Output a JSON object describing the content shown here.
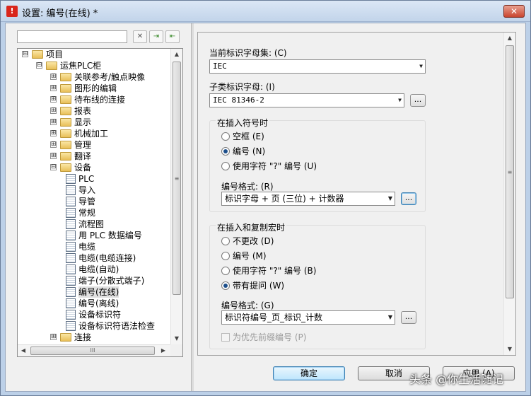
{
  "window": {
    "title": "设置: 编号(在线) *",
    "close_label": "✕",
    "app_icon": "warning-triangle-icon"
  },
  "search": {
    "value": "",
    "placeholder": ""
  },
  "toolbar": {
    "clear_label": "✕",
    "btn2_label": "⇥",
    "btn3_label": "⇤"
  },
  "tree": {
    "items": [
      {
        "label": "项目",
        "expander": "⊟",
        "icon": "folder"
      },
      {
        "label": "运焦PLC柜",
        "expander": "⊟",
        "icon": "folder"
      },
      {
        "label": "关联参考/触点映像",
        "expander": "⊞",
        "icon": "folder"
      },
      {
        "label": "图形的编辑",
        "expander": "⊞",
        "icon": "folder"
      },
      {
        "label": "待布线的连接",
        "expander": "⊞",
        "icon": "folder"
      },
      {
        "label": "报表",
        "expander": "⊞",
        "icon": "folder"
      },
      {
        "label": "显示",
        "expander": "⊞",
        "icon": "folder"
      },
      {
        "label": "机械加工",
        "expander": "⊞",
        "icon": "folder"
      },
      {
        "label": "管理",
        "expander": "⊞",
        "icon": "folder"
      },
      {
        "label": "翻译",
        "expander": "⊞",
        "icon": "folder"
      },
      {
        "label": "设备",
        "expander": "⊟",
        "icon": "folder"
      },
      {
        "label": "PLC",
        "icon": "page"
      },
      {
        "label": "导入",
        "icon": "page"
      },
      {
        "label": "导管",
        "icon": "page"
      },
      {
        "label": "常规",
        "icon": "page"
      },
      {
        "label": "流程图",
        "icon": "page"
      },
      {
        "label": "用 PLC 数据编号",
        "icon": "page"
      },
      {
        "label": "电缆",
        "icon": "page"
      },
      {
        "label": "电缆(电缆连接)",
        "icon": "page"
      },
      {
        "label": "电缆(自动)",
        "icon": "page"
      },
      {
        "label": "端子(分散式端子)",
        "icon": "page"
      },
      {
        "label": "编号(在线)",
        "icon": "page",
        "selected": true
      },
      {
        "label": "编号(离线)",
        "icon": "page"
      },
      {
        "label": "设备标识符",
        "icon": "page"
      },
      {
        "label": "设备标识符语法检查",
        "icon": "page"
      },
      {
        "label": "连接",
        "expander": "⊞",
        "icon": "folder"
      }
    ],
    "vscroll_up": "▲",
    "vscroll_down": "▼",
    "hscroll_left": "◀",
    "hscroll_right": "▶",
    "grip_v": "≡",
    "grip_h": "III"
  },
  "settings": {
    "alphabet_label": "当前标识字母集: (C)",
    "alphabet_value": "IEC",
    "subclass_label": "子类标识字母: (I)",
    "subclass_value": "IEC 81346-2",
    "insert_symbol": {
      "title": "在插入符号时",
      "options": [
        {
          "label": "空框 (E)",
          "checked": false
        },
        {
          "label": "编号 (N)",
          "checked": true
        },
        {
          "label": "使用字符 \"?\" 编号 (U)",
          "checked": false
        }
      ],
      "format_label": "编号格式: (R)",
      "format_value": "标识字母 + 页 (三位) + 计数器"
    },
    "insert_macro": {
      "title": "在插入和复制宏时",
      "options": [
        {
          "label": "不更改 (D)",
          "checked": false
        },
        {
          "label": "编号 (M)",
          "checked": false
        },
        {
          "label": "使用字符 \"?\" 编号 (B)",
          "checked": false
        },
        {
          "label": "带有提问 (W)",
          "checked": true
        }
      ],
      "format_label": "编号格式: (G)",
      "format_value": "标识符编号_页_标识_计数",
      "prefix_label": "为优先前缀编号 (P)"
    },
    "ellipsis": "...",
    "dropdown_glyph": "▼"
  },
  "buttons": {
    "ok": "确定",
    "cancel": "取消",
    "apply": "应用 (A)"
  },
  "watermark": "头条 @你生活随记"
}
